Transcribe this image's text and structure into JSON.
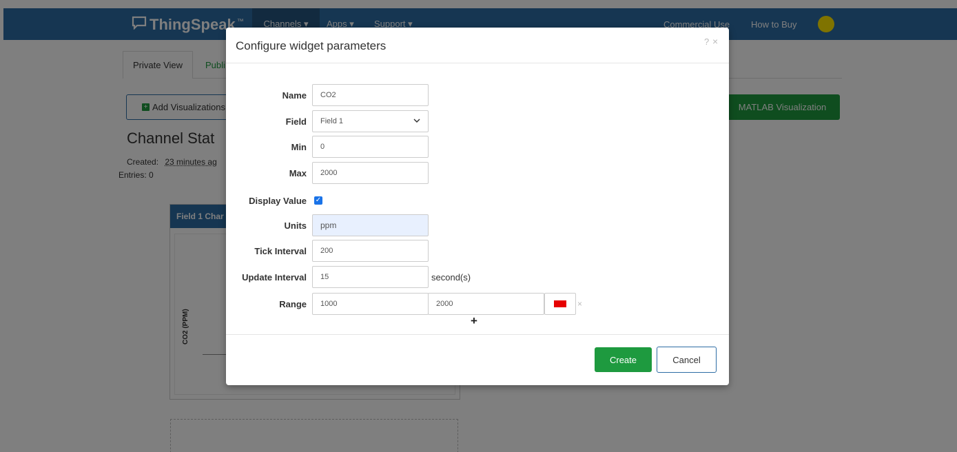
{
  "navbar": {
    "brand": "ThingSpeak",
    "brand_tm": "™",
    "channels": "Channels ▾",
    "apps": "Apps ▾",
    "support": "Support ▾",
    "commercial": "Commercial Use",
    "how_to_buy": "How to Buy",
    "avatar_color": "#ffe600",
    "bar_color": "#2d6ca4"
  },
  "tabs": {
    "private": "Private View",
    "public": "Publi"
  },
  "toolbar": {
    "add_visualizations": "Add Visualizations",
    "matlab_visualization": "MATLAB Visualization"
  },
  "channel": {
    "title": "Channel Stat",
    "created_label": "Created:",
    "created_value": "23 minutes ag",
    "entries": "Entries: 0"
  },
  "chart": {
    "header": "Field 1 Char",
    "y_label": "CO2 (PPM)"
  },
  "modal": {
    "title": "Configure widget parameters",
    "help": "?",
    "close": "×",
    "fields": {
      "name": {
        "label": "Name",
        "value": "CO2"
      },
      "field": {
        "label": "Field",
        "value": "Field 1"
      },
      "min": {
        "label": "Min",
        "value": "0"
      },
      "max": {
        "label": "Max",
        "value": "2000"
      },
      "display_value": {
        "label": "Display Value",
        "checked": true
      },
      "units": {
        "label": "Units",
        "value": "ppm"
      },
      "tick_interval": {
        "label": "Tick Interval",
        "value": "200"
      },
      "update_interval": {
        "label": "Update Interval",
        "value": "15",
        "suffix": "second(s)"
      },
      "range": {
        "label": "Range",
        "from": "1000",
        "to": "2000",
        "color": "#e60000",
        "remove": "×"
      }
    },
    "add_range": "+",
    "create": "Create",
    "cancel": "Cancel"
  }
}
